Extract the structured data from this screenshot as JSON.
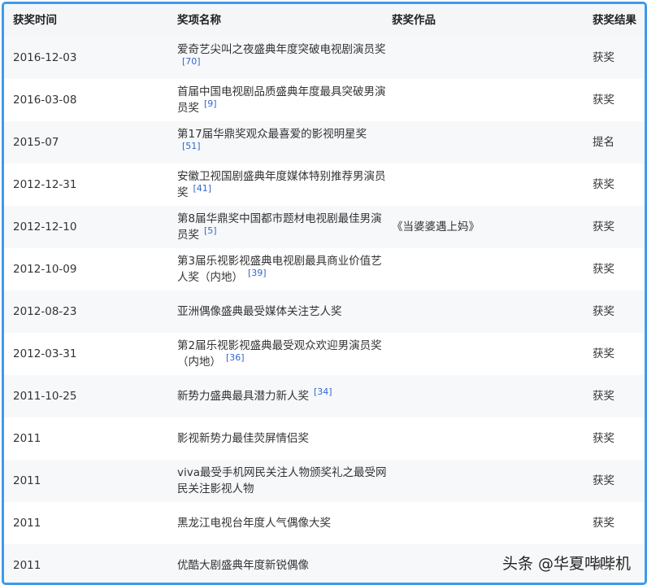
{
  "headers": [
    "获奖时间",
    "奖项名称",
    "获奖作品",
    "获奖结果"
  ],
  "rows": [
    {
      "date": "2016-12-03",
      "award": "爱奇艺尖叫之夜盛典年度突破电视剧演员奖",
      "ref": "[70]",
      "work": "",
      "result": "获奖"
    },
    {
      "date": "2016-03-08",
      "award": "首届中国电视剧品质盛典年度最具突破男演员奖",
      "ref": "[9]",
      "work": "",
      "result": "获奖"
    },
    {
      "date": "2015-07",
      "award": "第17届华鼎奖观众最喜爱的影视明星奖",
      "ref": "[51]",
      "work": "",
      "result": "提名"
    },
    {
      "date": "2012-12-31",
      "award": "安徽卫视国剧盛典年度媒体特别推荐男演员奖",
      "ref": "[41]",
      "work": "",
      "result": "获奖"
    },
    {
      "date": "2012-12-10",
      "award": "第8届华鼎奖中国都市题材电视剧最佳男演员奖",
      "ref": "[5]",
      "work": "《当婆婆遇上妈》",
      "result": "获奖"
    },
    {
      "date": "2012-10-09",
      "award": "第3届乐视影视盛典电视剧最具商业价值艺人奖（内地）",
      "ref": "[39]",
      "work": "",
      "result": "获奖"
    },
    {
      "date": "2012-08-23",
      "award": "亚洲偶像盛典最受媒体关注艺人奖",
      "ref": "",
      "work": "",
      "result": "获奖"
    },
    {
      "date": "2012-03-31",
      "award": "第2届乐视影视盛典最受观众欢迎男演员奖（内地）",
      "ref": "[36]",
      "work": "",
      "result": "获奖"
    },
    {
      "date": "2011-10-25",
      "award": "新势力盛典最具潜力新人奖",
      "ref": "[34]",
      "work": "",
      "result": "获奖"
    },
    {
      "date": "2011",
      "award": "影视新势力最佳荧屏情侣奖",
      "ref": "",
      "work": "",
      "result": "获奖"
    },
    {
      "date": "2011",
      "award": "viva最受手机网民关注人物颁奖礼之最受网民关注影视人物",
      "ref": "",
      "work": "",
      "result": "获奖"
    },
    {
      "date": "2011",
      "award": "黑龙江电视台年度人气偶像大奖",
      "ref": "",
      "work": "",
      "result": "获奖"
    },
    {
      "date": "2011",
      "award": "优酷大剧盛典年度新锐偶像",
      "ref": "",
      "work": "",
      "result": "获奖"
    }
  ],
  "watermark": "头条 @华夏哔哔机"
}
